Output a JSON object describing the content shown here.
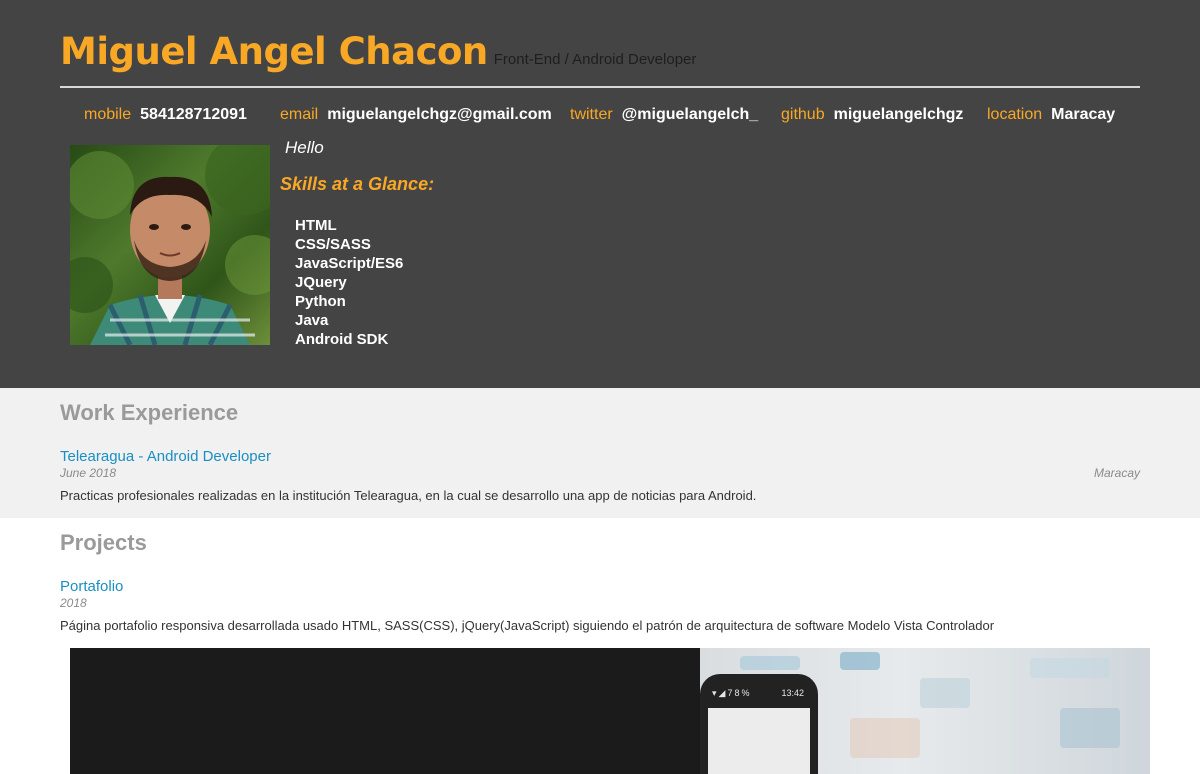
{
  "header": {
    "name": "Miguel Angel Chacon",
    "subtitle": "Front-End / Android Developer",
    "contacts": [
      {
        "key": "mobile",
        "value": "584128712091"
      },
      {
        "key": "email",
        "value": "miguelangelchgz@gmail.com"
      },
      {
        "key": "twitter",
        "value": "@miguelangelch_"
      },
      {
        "key": "github",
        "value": "miguelangelchgz"
      },
      {
        "key": "location",
        "value": "Maracay"
      }
    ],
    "greeting": "Hello",
    "skills_title": "Skills at a Glance:",
    "skills": [
      "HTML",
      "CSS/SASS",
      "JavaScript/ES6",
      "JQuery",
      "Python",
      "Java",
      "Android SDK"
    ]
  },
  "work": {
    "title": "Work Experience",
    "entries": [
      {
        "title": "Telearagua - Android Developer",
        "date": "June 2018",
        "location": "Maracay",
        "description": "Practicas profesionales realizadas en la institución Telearagua, en la cual se desarrollo una app de noticias para Android."
      }
    ]
  },
  "projects": {
    "title": "Projects",
    "entries": [
      {
        "title": "Portafolio",
        "date": "2018",
        "description": "Página portafolio responsiva desarrollada usado HTML, SASS(CSS), jQuery(JavaScript) siguiendo el patrón de arquitectura de software Modelo Vista Controlador",
        "screenshot_time": "13:42",
        "screenshot_battery": "78%"
      }
    ]
  },
  "colors": {
    "accent": "#f9a825",
    "header_bg": "#444444",
    "link": "#1a8fc1",
    "section_title": "#9a9a9a"
  }
}
